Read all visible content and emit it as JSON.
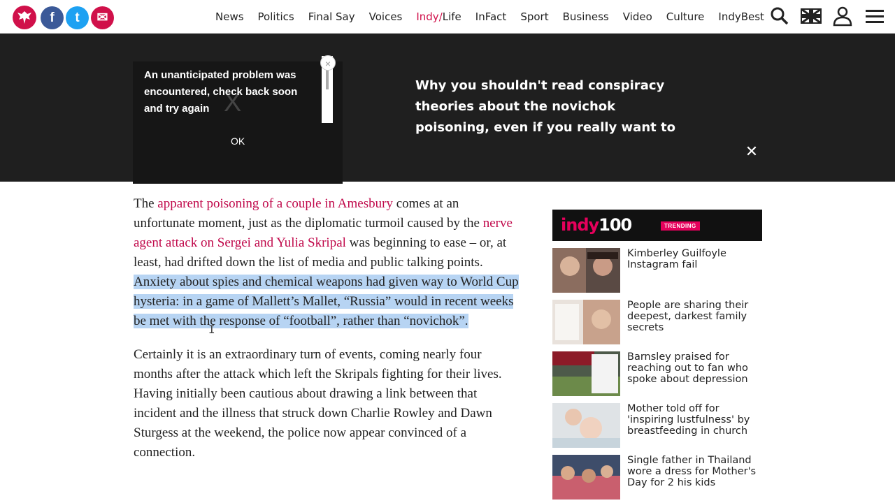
{
  "nav": {
    "links": [
      "News",
      "Politics",
      "Final Say",
      "Voices",
      "Indy/",
      "Life",
      "InFact",
      "Sport",
      "Business",
      "Video",
      "Culture",
      "IndyBest"
    ],
    "accent": "#d0104a",
    "share": {
      "facebook": "f",
      "twitter": "t",
      "email": "✉"
    }
  },
  "banner": {
    "video_error": "An unanticipated problem was encountered, check back soon and try again",
    "video_x": "X",
    "video_ok": "OK",
    "video_close": "×",
    "headline": "Why you shouldn't read conspiracy theories about the novichok poisoning, even if you really want to",
    "close": "✕"
  },
  "article": {
    "p1_a": "The ",
    "p1_link1": "apparent poisoning of a couple in Amesbury",
    "p1_b": " comes at an unfortunate moment, just as the diplomatic turmoil caused by the ",
    "p1_link2": "nerve agent attack on Sergei and Yulia Skripal",
    "p1_c": " was beginning to ease – or, at least, had drifted down the list of media and public talking points. ",
    "p1_highlight": "Anxiety about spies and chemical weapons had given way to World Cup hysteria: in a game of Mallett’s Mallet, “Russia” would in recent weeks be met with the response of “football”, rather than “novichok”.",
    "p2": "Certainly it is an extraordinary turn of events, coming nearly four months after the attack which left the Skripals fighting for their lives. Having initially been cautious about drawing a link between that incident and the illness that struck down Charlie Rowley and Dawn Sturgess at the weekend, the police now appear convinced of a connection.",
    "cursor": "I"
  },
  "sidebar": {
    "logo_a": "indy",
    "logo_b": "100",
    "badge": "TRENDING",
    "items": [
      {
        "title": "Kimberley Guilfoyle Instagram fail"
      },
      {
        "title": "People are sharing their deepest, darkest family secrets"
      },
      {
        "title": "Barnsley praised for reaching out to fan who spoke about depression"
      },
      {
        "title": "Mother told off for 'inspiring lustfulness' by breastfeeding in church"
      },
      {
        "title": "Single father in Thailand wore a dress for Mother's Day for 2 his kids"
      }
    ]
  }
}
